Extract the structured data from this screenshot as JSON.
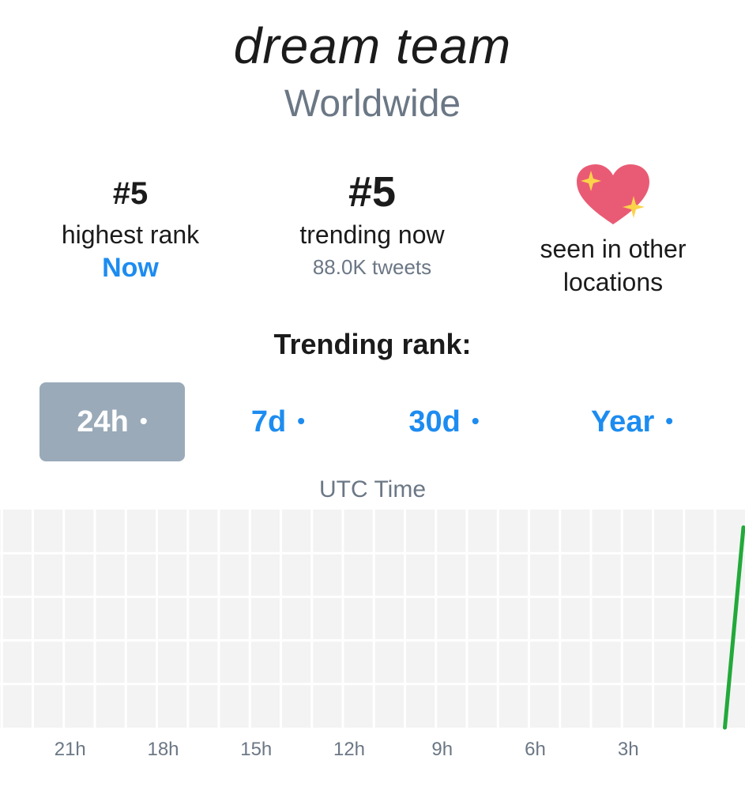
{
  "header": {
    "title": "dream team",
    "location": "Worldwide"
  },
  "stats": {
    "highest": {
      "value": "#5",
      "label": "highest rank",
      "when": "Now"
    },
    "trending": {
      "value": "#5",
      "label": "trending now",
      "tweets": "88.0K tweets"
    },
    "seen": {
      "icon": "sparkling-heart-icon",
      "label_line1": "seen in other",
      "label_line2": "locations"
    }
  },
  "rank_section": {
    "heading": "Trending rank:",
    "tabs": [
      {
        "label": "24h",
        "dot": "•",
        "active": true
      },
      {
        "label": "7d",
        "dot": "•",
        "active": false
      },
      {
        "label": "30d",
        "dot": "•",
        "active": false
      },
      {
        "label": "Year",
        "dot": "•",
        "active": false
      }
    ],
    "axis_title": "UTC Time"
  },
  "colors": {
    "accent": "#1d8cf0",
    "active_tab": "#9aaab9",
    "line": "#22a93a",
    "grid_bg": "#f3f3f3",
    "muted_text": "#6b7785"
  },
  "chart_data": {
    "type": "line",
    "xlabel": "UTC Time",
    "x_tick_labels": [
      "21h",
      "18h",
      "15h",
      "12h",
      "9h",
      "6h",
      "3h"
    ],
    "x_hours_ago_range": [
      24,
      0
    ],
    "series": [
      {
        "points": [
          {
            "hours_ago": 0.6,
            "rank": 50
          },
          {
            "hours_ago": 0,
            "rank": 5
          }
        ]
      }
    ],
    "y_range": [
      50,
      1
    ],
    "grid": true
  }
}
